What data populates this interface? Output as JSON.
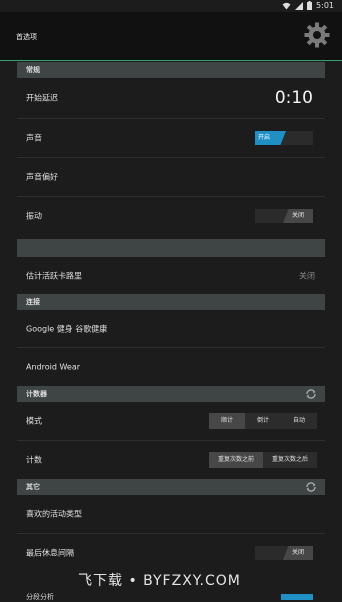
{
  "status": {
    "time": "5:01"
  },
  "app": {
    "title": "首选项"
  },
  "sections": {
    "general": {
      "title": "常规"
    },
    "connect": {
      "title": "连接"
    },
    "counter": {
      "title": "计数器"
    },
    "other": {
      "title": "其它"
    }
  },
  "rows": {
    "start_delay": {
      "label": "开始延迟",
      "value": "0:10"
    },
    "sound": {
      "label": "声音",
      "toggle": "开启"
    },
    "sound_pref": {
      "label": "声音偏好"
    },
    "vibration": {
      "label": "振动",
      "toggle": "关闭"
    },
    "estimate": {
      "label": "估计活跃卡路里",
      "value": "关闭"
    },
    "google_fit": {
      "label": "Google 健身 谷歌健康"
    },
    "android_wear": {
      "label": "Android Wear"
    },
    "mode": {
      "label": "模式",
      "options": [
        "顺计",
        "倒计",
        "自动"
      ]
    },
    "count": {
      "label": "计数",
      "options": [
        "重复次数之前",
        "重复次数之后"
      ]
    },
    "fav_type": {
      "label": "喜欢的活动类型"
    },
    "last_rest": {
      "label": "最后休息间隔",
      "toggle": "关闭"
    },
    "partial": {
      "label": "分段分析"
    }
  },
  "watermark": "飞下载 • BYFZXY.COM",
  "colors": {
    "accent_blue": "#1f90c4",
    "accent_green": "#3aa06a",
    "header_bg": "#3f4445"
  }
}
